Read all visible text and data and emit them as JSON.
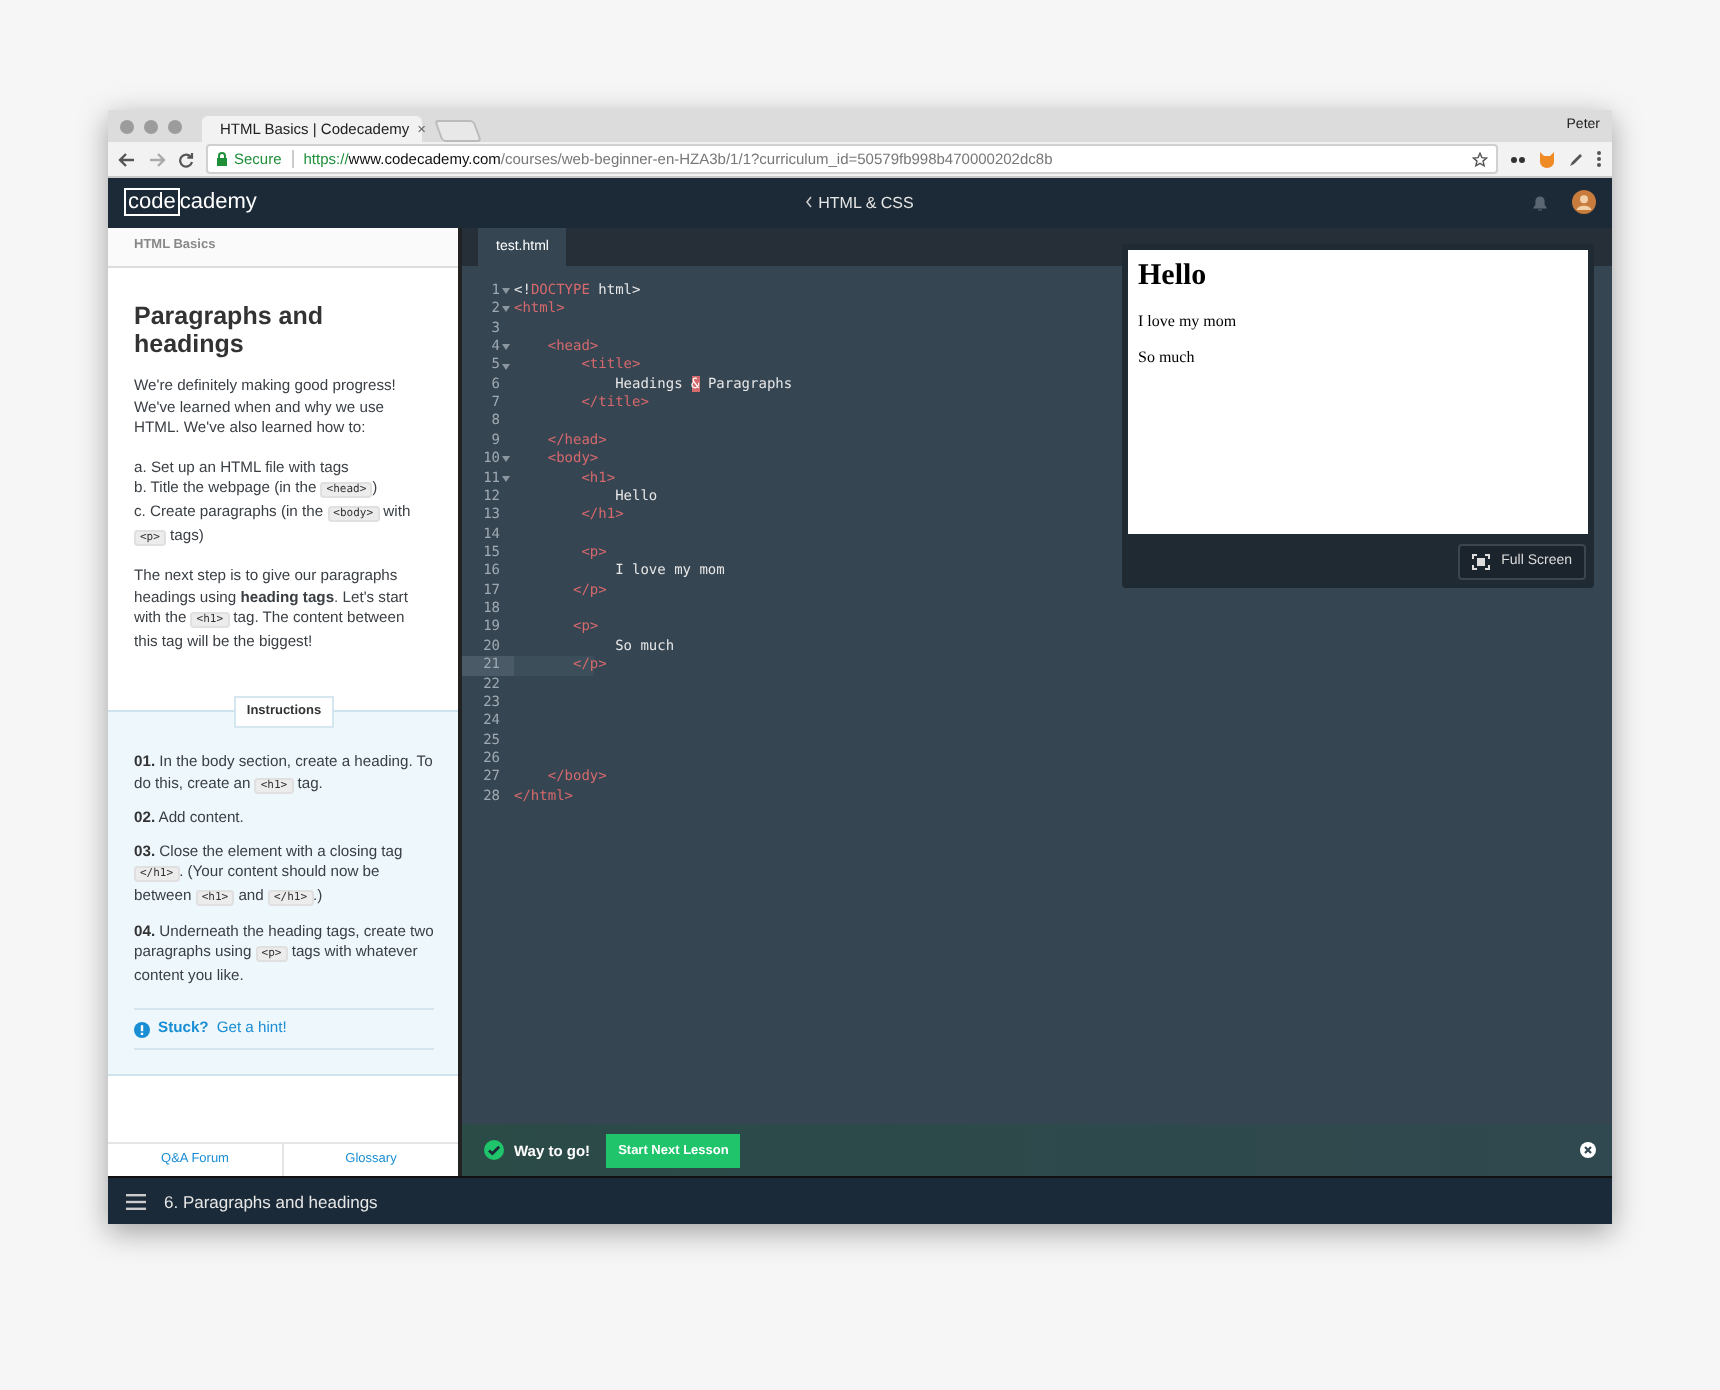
{
  "browser": {
    "tab": {
      "title": "HTML Basics | Codecademy",
      "close": "×"
    },
    "user": "Peter",
    "address": {
      "secure_label": "Secure",
      "scheme": "https://",
      "host": "www.codecademy.com",
      "path": "/courses/web-beginner-en-HZA3b/1/1?curriculum_id=50579fb998b470000202dc8b"
    }
  },
  "navbar": {
    "logo_boxed": "code",
    "logo_rest": "cademy",
    "course": "HTML & CSS"
  },
  "lesson": {
    "breadcrumb": "HTML Basics",
    "title": "Paragraphs and headings",
    "blocks": [
      {
        "kind": "paragraph",
        "parts": [
          {
            "kind": "text",
            "t": "We're definitely making good progress! We've learned when and why we use HTML. We've also learned how to:"
          }
        ]
      },
      {
        "kind": "list",
        "items": [
          [
            {
              "kind": "text",
              "t": "a. Set up an HTML file with tags"
            }
          ],
          [
            {
              "kind": "text",
              "t": "b. Title the webpage (in the "
            },
            {
              "kind": "code",
              "t": "<head>"
            },
            {
              "kind": "text",
              "t": ")"
            }
          ],
          [
            {
              "kind": "text",
              "t": "c. Create paragraphs (in the "
            },
            {
              "kind": "code",
              "t": "<body>"
            },
            {
              "kind": "text",
              "t": " with "
            },
            {
              "kind": "code",
              "t": "<p>"
            },
            {
              "kind": "text",
              "t": " tags)"
            }
          ]
        ]
      },
      {
        "kind": "paragraph",
        "parts": [
          {
            "kind": "text",
            "t": "The next step is to give our paragraphs headings using "
          },
          {
            "kind": "bold",
            "t": "heading tags"
          },
          {
            "kind": "text",
            "t": ". Let's start with the "
          },
          {
            "kind": "code",
            "t": "<h1>"
          },
          {
            "kind": "text",
            "t": " tag. The content between this tag will be the biggest!"
          }
        ]
      }
    ],
    "instructions_label": "Instructions",
    "steps": [
      {
        "number": "01.",
        "parts": [
          {
            "kind": "text",
            "t": "In the body section, create a heading. To do this, create an "
          },
          {
            "kind": "code",
            "t": "<h1>"
          },
          {
            "kind": "text",
            "t": " tag."
          }
        ]
      },
      {
        "number": "02.",
        "parts": [
          {
            "kind": "text",
            "t": "Add content."
          }
        ]
      },
      {
        "number": "03.",
        "parts": [
          {
            "kind": "text",
            "t": "Close the element with a closing tag "
          },
          {
            "kind": "code",
            "t": "</h1>"
          },
          {
            "kind": "text",
            "t": ". (Your content should now be between "
          },
          {
            "kind": "code",
            "t": "<h1>"
          },
          {
            "kind": "text",
            "t": " and "
          },
          {
            "kind": "code",
            "t": "</h1>"
          },
          {
            "kind": "text",
            "t": ".)"
          }
        ]
      },
      {
        "number": "04.",
        "parts": [
          {
            "kind": "text",
            "t": "Underneath the heading tags, create two paragraphs using "
          },
          {
            "kind": "code",
            "t": "<p>"
          },
          {
            "kind": "text",
            "t": " tags with whatever content you like."
          }
        ]
      }
    ],
    "hint": {
      "label": "Stuck?",
      "link": "Get a hint!"
    },
    "footer_links": [
      "Q&A Forum",
      "Glossary"
    ]
  },
  "editor": {
    "tabs": [
      {
        "label": "test.html",
        "selected": true
      }
    ],
    "lines": [
      {
        "number": "1",
        "fold": true,
        "active": false,
        "tokens": [
          {
            "kind": "punct",
            "t": "<!"
          },
          {
            "kind": "keyword",
            "t": "DOCTYPE"
          },
          {
            "kind": "punct",
            "t": " html>"
          }
        ]
      },
      {
        "number": "2",
        "fold": true,
        "active": false,
        "tokens": [
          {
            "kind": "tag",
            "t": "<html>"
          }
        ]
      },
      {
        "number": "3",
        "fold": false,
        "active": false
      },
      {
        "number": "4",
        "fold": true,
        "active": false,
        "tokens": [
          {
            "kind": "tag",
            "t": "    <head>"
          }
        ]
      },
      {
        "number": "5",
        "fold": true,
        "active": false,
        "tokens": [
          {
            "kind": "tag",
            "t": "        <title>"
          }
        ]
      },
      {
        "number": "6",
        "fold": false,
        "active": false,
        "tokens": [
          {
            "kind": "text",
            "t": "            Headings "
          },
          {
            "kind": "invalid",
            "t": "&"
          },
          {
            "kind": "text",
            "t": " Paragraphs"
          }
        ]
      },
      {
        "number": "7",
        "fold": false,
        "active": false,
        "tokens": [
          {
            "kind": "tag",
            "t": "        </title>"
          }
        ]
      },
      {
        "number": "8",
        "fold": false,
        "active": false
      },
      {
        "number": "9",
        "fold": false,
        "active": false,
        "tokens": [
          {
            "kind": "tag",
            "t": "    </head>"
          }
        ]
      },
      {
        "number": "10",
        "fold": true,
        "active": false,
        "tokens": [
          {
            "kind": "tag",
            "t": "    <body>"
          }
        ]
      },
      {
        "number": "11",
        "fold": true,
        "active": false,
        "tokens": [
          {
            "kind": "tag",
            "t": "        <h1>"
          }
        ]
      },
      {
        "number": "12",
        "fold": false,
        "active": false,
        "tokens": [
          {
            "kind": "text",
            "t": "            Hello"
          }
        ]
      },
      {
        "number": "13",
        "fold": false,
        "active": false,
        "tokens": [
          {
            "kind": "tag",
            "t": "        </h1>"
          }
        ]
      },
      {
        "number": "14",
        "fold": false,
        "active": false
      },
      {
        "number": "15",
        "fold": false,
        "active": false,
        "tokens": [
          {
            "kind": "tag",
            "t": "        <p>"
          }
        ]
      },
      {
        "number": "16",
        "fold": false,
        "active": false,
        "tokens": [
          {
            "kind": "text",
            "t": "            I love my mom"
          }
        ]
      },
      {
        "number": "17",
        "fold": false,
        "active": false,
        "tokens": [
          {
            "kind": "tag",
            "t": "       </p>"
          }
        ]
      },
      {
        "number": "18",
        "fold": false,
        "active": false
      },
      {
        "number": "19",
        "fold": false,
        "active": false,
        "tokens": [
          {
            "kind": "tag",
            "t": "       <p>"
          }
        ]
      },
      {
        "number": "20",
        "fold": false,
        "active": false,
        "tokens": [
          {
            "kind": "text",
            "t": "            So much"
          }
        ]
      },
      {
        "number": "21",
        "fold": false,
        "active": true,
        "tokens": [
          {
            "kind": "tag",
            "t": "       </p>"
          }
        ]
      },
      {
        "number": "22",
        "fold": false,
        "active": false
      },
      {
        "number": "23",
        "fold": false,
        "active": false
      },
      {
        "number": "24",
        "fold": false,
        "active": false
      },
      {
        "number": "25",
        "fold": false,
        "active": false
      },
      {
        "number": "26",
        "fold": false,
        "active": false
      },
      {
        "number": "27",
        "fold": false,
        "active": false,
        "tokens": [
          {
            "kind": "tag",
            "t": "    </body>"
          }
        ]
      },
      {
        "number": "28",
        "fold": false,
        "active": false,
        "tokens": [
          {
            "kind": "tag",
            "t": "</html>"
          }
        ]
      }
    ]
  },
  "preview": {
    "heading": "Hello",
    "paragraphs": [
      "I love my mom",
      "So much"
    ],
    "fullscreen_button": "Full Screen"
  },
  "success": {
    "message": "Way to go!",
    "button": "Start Next Lesson"
  },
  "bottom_bar": {
    "lesson": "6. Paragraphs and headings"
  }
}
